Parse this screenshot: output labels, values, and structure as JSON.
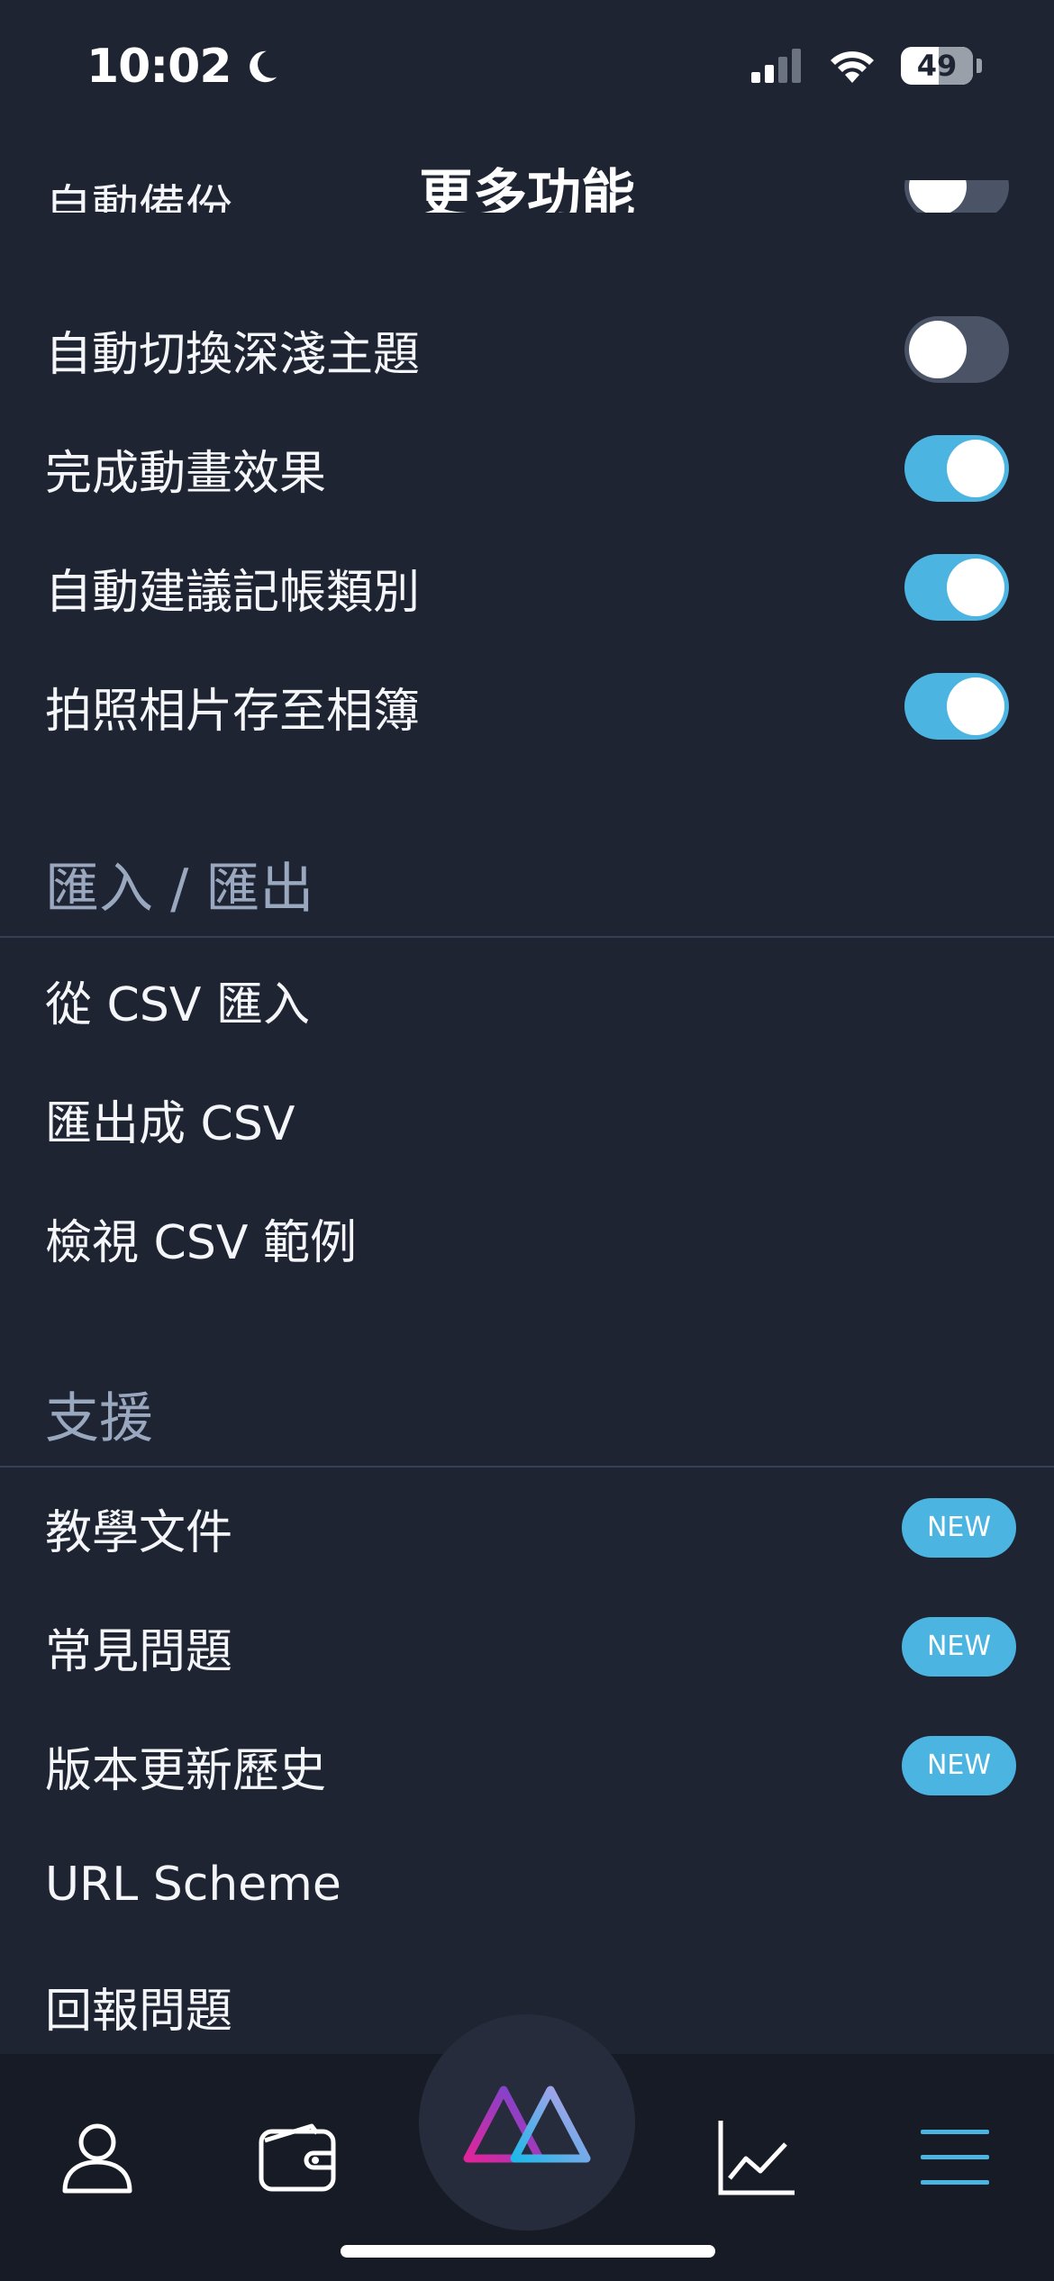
{
  "status_bar": {
    "time": "10:02",
    "battery": "49"
  },
  "header": {
    "title": "更多功能"
  },
  "settings": {
    "partial_label": "自動備份",
    "rows": [
      {
        "label": "自動切換深淺主題",
        "on": false
      },
      {
        "label": "完成動畫效果",
        "on": true
      },
      {
        "label": "自動建議記帳類別",
        "on": true
      },
      {
        "label": "拍照相片存至相簿",
        "on": true
      }
    ]
  },
  "import_export": {
    "header": "匯入 / 匯出",
    "items": [
      "從 CSV 匯入",
      "匯出成 CSV",
      "檢視 CSV 範例"
    ]
  },
  "support": {
    "header": "支援",
    "badge": "NEW",
    "items": [
      "教學文件",
      "常見問題",
      "版本更新歷史",
      "URL Scheme",
      "回報問題"
    ]
  },
  "tabbar": {
    "tabs": [
      "person-icon",
      "wallet-icon",
      "app-logo-icon",
      "chart-icon",
      "menu-icon"
    ],
    "active": "menu-icon",
    "accent": "#4cb4e0"
  }
}
